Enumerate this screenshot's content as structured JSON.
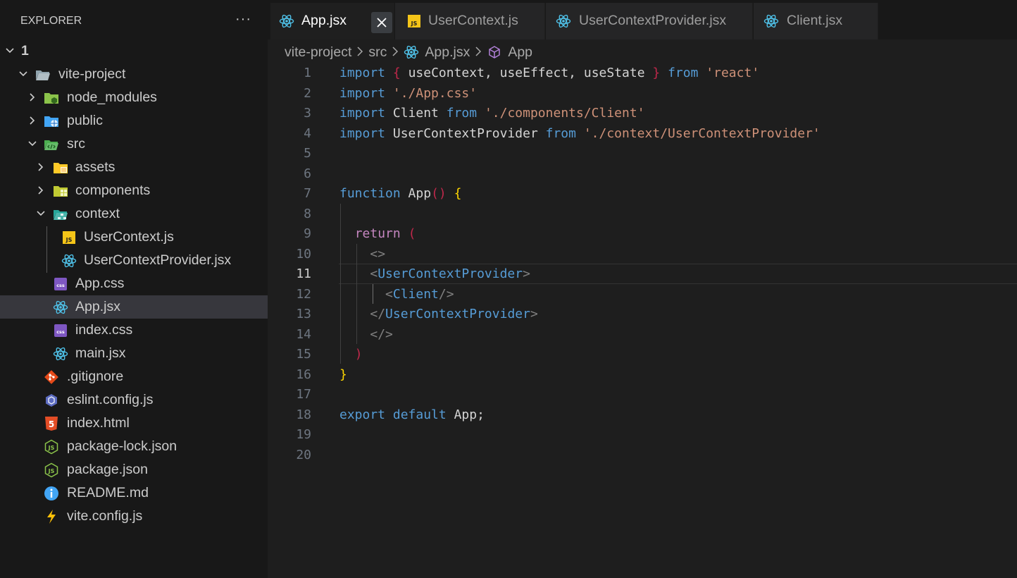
{
  "explorer": {
    "title": "EXPLORER",
    "more_label": "···",
    "tree": [
      {
        "label": "1",
        "icon": "chevron-down-icon",
        "depth": 0,
        "type": "root"
      },
      {
        "label": "vite-project",
        "icon": "folder-open-icon",
        "depth": 1,
        "type": "folder",
        "expanded": true
      },
      {
        "label": "node_modules",
        "icon": "node-folder-icon",
        "depth": 2,
        "type": "folder",
        "expanded": false
      },
      {
        "label": "public",
        "icon": "public-folder-icon",
        "depth": 2,
        "type": "folder",
        "expanded": false
      },
      {
        "label": "src",
        "icon": "src-folder-icon",
        "depth": 2,
        "type": "folder",
        "expanded": true
      },
      {
        "label": "assets",
        "icon": "assets-folder-icon",
        "depth": 3,
        "type": "folder",
        "expanded": false
      },
      {
        "label": "components",
        "icon": "components-folder-icon",
        "depth": 3,
        "type": "folder",
        "expanded": false
      },
      {
        "label": "context",
        "icon": "context-folder-icon",
        "depth": 3,
        "type": "folder",
        "expanded": true
      },
      {
        "label": "UserContext.js",
        "icon": "js-file-icon",
        "depth": 4,
        "type": "file"
      },
      {
        "label": "UserContextProvider.jsx",
        "icon": "react-icon",
        "depth": 4,
        "type": "file"
      },
      {
        "label": "App.css",
        "icon": "css-file-icon",
        "depth": 3,
        "type": "file"
      },
      {
        "label": "App.jsx",
        "icon": "react-icon",
        "depth": 3,
        "type": "file",
        "selected": true
      },
      {
        "label": "index.css",
        "icon": "css-file-icon",
        "depth": 3,
        "type": "file"
      },
      {
        "label": "main.jsx",
        "icon": "react-icon",
        "depth": 3,
        "type": "file"
      },
      {
        "label": ".gitignore",
        "icon": "git-icon",
        "depth": 2,
        "type": "file"
      },
      {
        "label": "eslint.config.js",
        "icon": "eslint-icon",
        "depth": 2,
        "type": "file"
      },
      {
        "label": "index.html",
        "icon": "html-file-icon",
        "depth": 2,
        "type": "file"
      },
      {
        "label": "package-lock.json",
        "icon": "node-file-icon",
        "depth": 2,
        "type": "file"
      },
      {
        "label": "package.json",
        "icon": "node-file-icon",
        "depth": 2,
        "type": "file"
      },
      {
        "label": "README.md",
        "icon": "info-icon",
        "depth": 2,
        "type": "file"
      },
      {
        "label": "vite.config.js",
        "icon": "vite-icon",
        "depth": 2,
        "type": "file"
      }
    ]
  },
  "tabs": [
    {
      "label": "App.jsx",
      "icon": "react-icon",
      "active": true
    },
    {
      "label": "UserContext.js",
      "icon": "js-file-icon",
      "active": false
    },
    {
      "label": "UserContextProvider.jsx",
      "icon": "react-icon",
      "active": false
    },
    {
      "label": "Client.jsx",
      "icon": "react-icon",
      "active": false
    }
  ],
  "breadcrumb": {
    "items": [
      "vite-project",
      "src",
      "App.jsx",
      "App"
    ]
  },
  "editor": {
    "current_line": 11,
    "line_numbers": [
      "1",
      "2",
      "3",
      "4",
      "5",
      "6",
      "7",
      "8",
      "9",
      "10",
      "11",
      "12",
      "13",
      "14",
      "15",
      "16",
      "17",
      "18",
      "19",
      "20"
    ],
    "lines": [
      "import { useContext, useEffect, useState } from 'react'",
      "import './App.css'",
      "import Client from './components/Client'",
      "import UserContextProvider from './context/UserContextProvider'",
      "",
      "",
      "function App() {",
      "",
      "  return (",
      "    <>",
      "    <UserContextProvider>",
      "      <Client/>",
      "    </UserContextProvider>",
      "    </>",
      "  )",
      "}",
      "",
      "export default App;",
      "",
      ""
    ]
  },
  "colors": {
    "keyword": "#569cd6",
    "string": "#ce9178",
    "control": "#c586c0",
    "bracket_gold": "#ffd700",
    "react": "#4fc1e8",
    "js_yellow": "#f5c518"
  }
}
